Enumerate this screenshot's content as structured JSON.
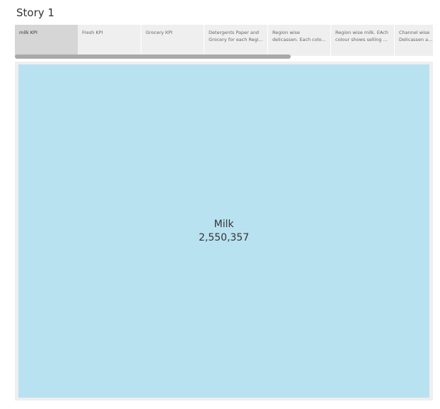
{
  "story": {
    "title": "Story 1"
  },
  "story_points": [
    {
      "line1": "milk KPI",
      "line2": "",
      "active": true
    },
    {
      "line1": "Fresh KPI",
      "line2": "",
      "active": false
    },
    {
      "line1": "Grocery KPI",
      "line2": "",
      "active": false
    },
    {
      "line1": "Detergents Paper and",
      "line2": "Grocery for each Regi...",
      "active": false
    },
    {
      "line1": "Region wise",
      "line2": "delicassen. Each colo...",
      "active": false
    },
    {
      "line1": "Region wise milk. EAch",
      "line2": "colour shows selling ...",
      "active": false
    },
    {
      "line1": "Channel wise",
      "line2": "Delicassen a...",
      "active": false
    }
  ],
  "colors": {
    "mark_fill": "#b9e2f1",
    "active_tab": "#d6d6d6",
    "strip_bg": "#efefef"
  },
  "chart_data": {
    "type": "treemap",
    "title": "",
    "cells": [
      {
        "label": "Milk",
        "value": 2550357,
        "value_text": "2,550,357"
      }
    ]
  }
}
